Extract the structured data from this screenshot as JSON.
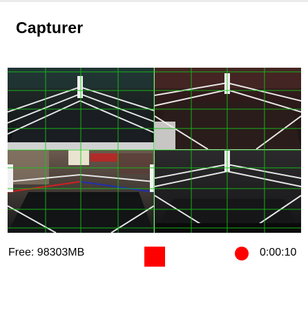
{
  "app": {
    "title": "Capturer"
  },
  "preview": {
    "cameras": [
      "camera-top-left",
      "camera-top-right",
      "camera-bottom-left",
      "camera-bottom-right"
    ],
    "grid_color": "#16c416"
  },
  "status": {
    "free_space": "Free: 98303MB",
    "elapsed": "0:00:10",
    "recording": true
  },
  "colors": {
    "stop": "#ff0000",
    "recording": "#ff0000"
  }
}
